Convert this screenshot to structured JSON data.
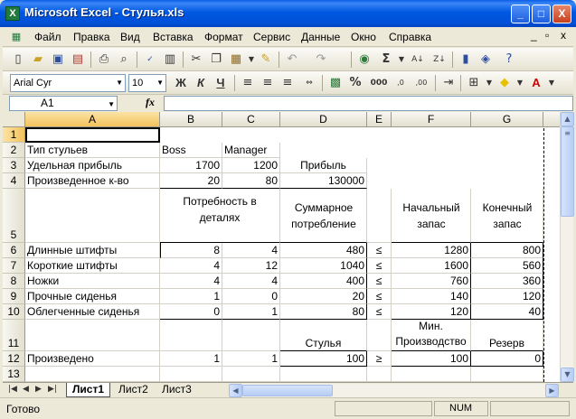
{
  "window": {
    "title": "Microsoft Excel - Стулья.xls",
    "minimize": "_",
    "maximize": "□",
    "close": "X",
    "doc_min": "_",
    "doc_restore": "▫",
    "doc_close": "x"
  },
  "menu": [
    "Файл",
    "Правка",
    "Вид",
    "Вставка",
    "Формат",
    "Сервис",
    "Данные",
    "Окно",
    "Справка"
  ],
  "format_toolbar": {
    "font": "Arial Cyr",
    "size": "10",
    "bold": "Ж",
    "italic": "К",
    "underline": "Ч",
    "percent": "%",
    "thousands": "000",
    "dec_inc": ",0",
    "dec_dec": ",00"
  },
  "formula_bar": {
    "name_box": "A1",
    "fx": "fx",
    "content": ""
  },
  "columns": [
    "A",
    "B",
    "C",
    "D",
    "E",
    "F",
    "G"
  ],
  "rows": [
    "1",
    "2",
    "3",
    "4",
    "5",
    "6",
    "7",
    "8",
    "9",
    "10",
    "11",
    "12",
    "13"
  ],
  "cells": {
    "A2": "Тип стульев",
    "B2": "Boss",
    "C2": "Manager",
    "A3": "Удельная прибыль",
    "B3": "1700",
    "C3": "1200",
    "D3": "Прибыль",
    "A4": "Произведенное к-во",
    "B4": "20",
    "C4": "80",
    "D4": "130000",
    "BC5": "Потребность в деталях",
    "D5": "Суммарное потребление",
    "F5": "Начальный запас",
    "G5": "Конечный запас",
    "A6": "Длинные штифты",
    "B6": "8",
    "C6": "4",
    "D6": "480",
    "E6": "≤",
    "F6": "1280",
    "G6": "800",
    "A7": "Короткие штифты",
    "B7": "4",
    "C7": "12",
    "D7": "1040",
    "E7": "≤",
    "F7": "1600",
    "G7": "560",
    "A8": "Ножки",
    "B8": "4",
    "C8": "4",
    "D8": "400",
    "E8": "≤",
    "F8": "760",
    "G8": "360",
    "A9": "Прочные сиденья",
    "B9": "1",
    "C9": "0",
    "D9": "20",
    "E9": "≤",
    "F9": "140",
    "G9": "120",
    "A10": "Облегченные сиденья",
    "B10": "0",
    "C10": "1",
    "D10": "80",
    "E10": "≤",
    "F10": "120",
    "G10": "40",
    "D11": "Стулья",
    "F11": "Мин. Производство",
    "G11": "Резерв",
    "A12": "Произведено",
    "B12": "1",
    "C12": "1",
    "D12": "100",
    "E12": "≥",
    "F12": "100",
    "G12": "0"
  },
  "sheets": [
    "Лист1",
    "Лист2",
    "Лист3"
  ],
  "status": {
    "text": "Готово",
    "num": "NUM"
  },
  "colors": {
    "title_bar": "#0058e0",
    "excel_green": "#1f7a3b",
    "selected_header": "#f3c25d"
  }
}
